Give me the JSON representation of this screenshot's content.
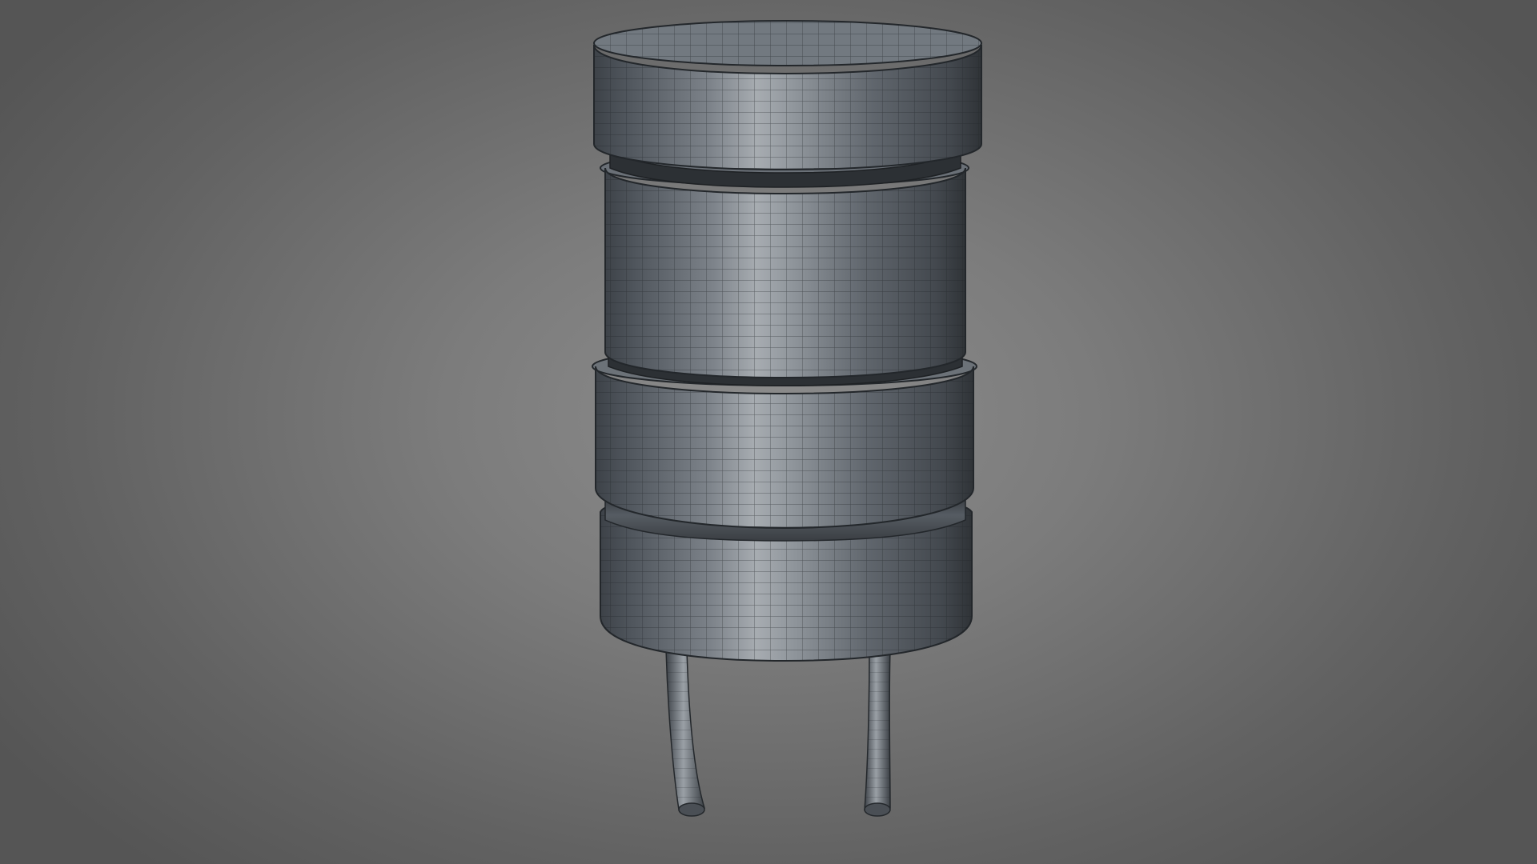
{
  "viewport": {
    "background_center": "#8c8c8c",
    "background_edge": "#555555"
  },
  "model": {
    "name": "inductor-wireframe-model",
    "body_color": "#5a6068",
    "body_highlight": "#a4a9ae",
    "wire_color": "#1f2226"
  }
}
